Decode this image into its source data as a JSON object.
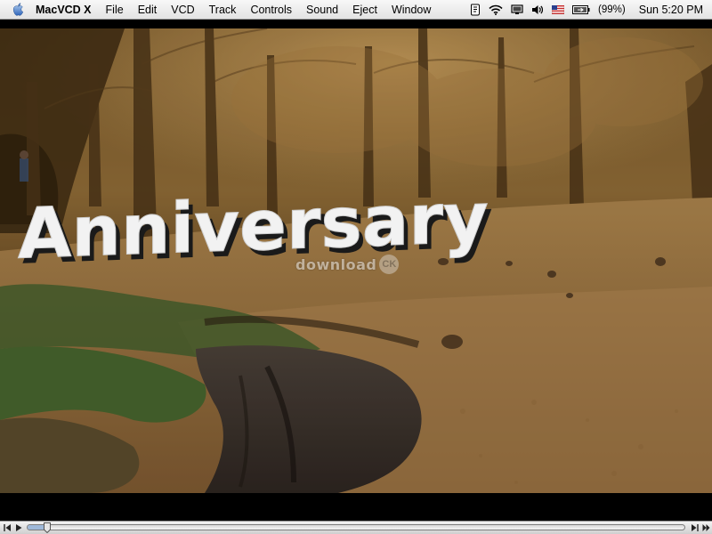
{
  "menubar": {
    "apple_icon": "apple-logo-icon",
    "app_name": "MacVCD X",
    "menus": [
      "File",
      "Edit",
      "VCD",
      "Track",
      "Controls",
      "Sound",
      "Eject",
      "Window"
    ],
    "extras": {
      "icons": [
        "script-menu-icon",
        "wifi-icon",
        "display-icon",
        "volume-icon",
        "us-flag-input-icon",
        "battery-icon"
      ],
      "battery_percent": "(99%)",
      "clock": "Sun 5:20 PM"
    }
  },
  "video": {
    "caption": "Anniversary",
    "watermark_text": "download",
    "watermark_badge": "CK"
  },
  "controller": {
    "buttons": [
      "step-back-button",
      "play-button",
      "step-forward-button",
      "loop-button"
    ],
    "progress": 0.03
  },
  "colors": {
    "menubar_bg": "#e9e9e9",
    "caption_fill": "#f2f2f2",
    "caption_shadow": "#1a1a1a",
    "autumn_dark": "#3d2a12",
    "autumn_mid": "#8a6532",
    "autumn_light": "#c49b5b",
    "grass": "#3f5d2a"
  }
}
